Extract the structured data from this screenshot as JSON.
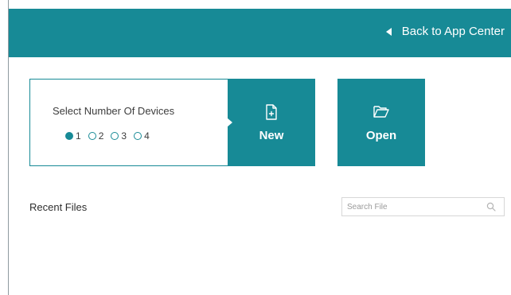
{
  "header": {
    "back_label": "Back to App Center",
    "color": "#178a96"
  },
  "device_selector": {
    "title": "Select Number Of Devices",
    "options": [
      "1",
      "2",
      "3",
      "4"
    ],
    "selected": "1"
  },
  "actions": {
    "new_label": "New",
    "new_icon": "new-file-icon",
    "open_label": "Open",
    "open_icon": "folder-open-icon"
  },
  "recent": {
    "label": "Recent Files",
    "search_placeholder": "Search File",
    "search_icon": "search-icon"
  }
}
